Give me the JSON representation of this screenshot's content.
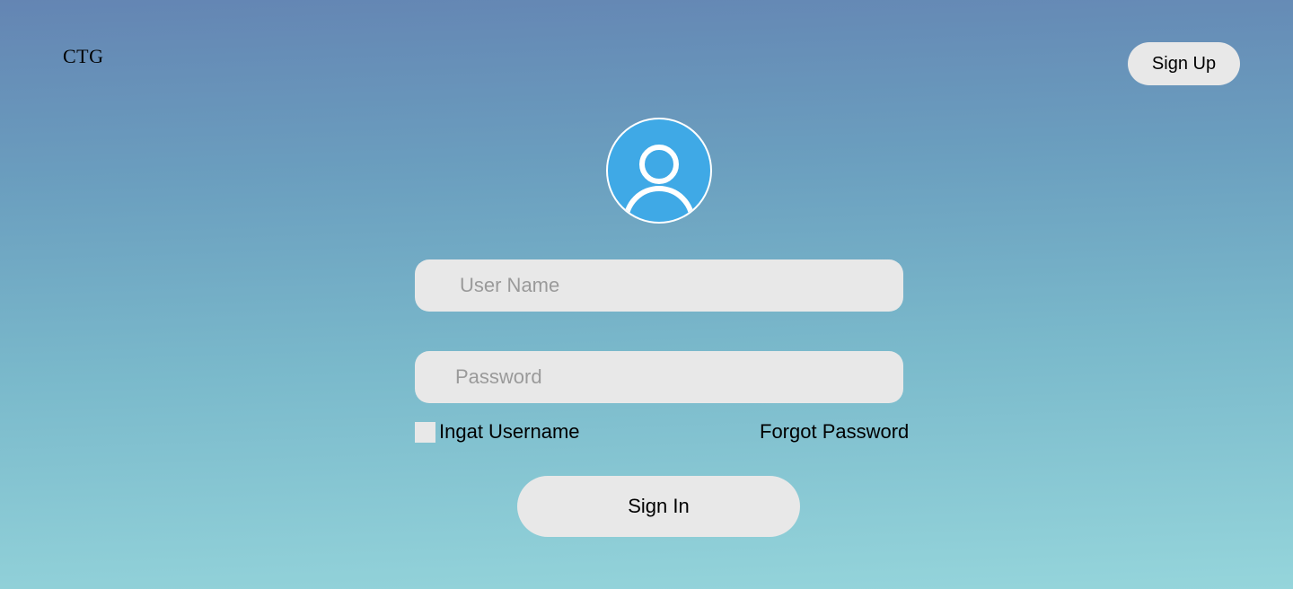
{
  "header": {
    "logo_text": "CTG",
    "signup_label": "Sign Up"
  },
  "login": {
    "avatar_icon": "user-icon",
    "username_placeholder": "User Name",
    "username_value": "",
    "password_placeholder": "Password",
    "password_value": "",
    "remember_label": "Ingat Username",
    "remember_checked": false,
    "forgot_label": "Forgot Password",
    "signin_label": "Sign In"
  },
  "colors": {
    "gradient_top": "#6485b3",
    "gradient_bottom": "#95d5db",
    "avatar_bg": "#3fa9e6",
    "control_bg": "#e8e8e8",
    "placeholder": "#9a9a9a"
  }
}
